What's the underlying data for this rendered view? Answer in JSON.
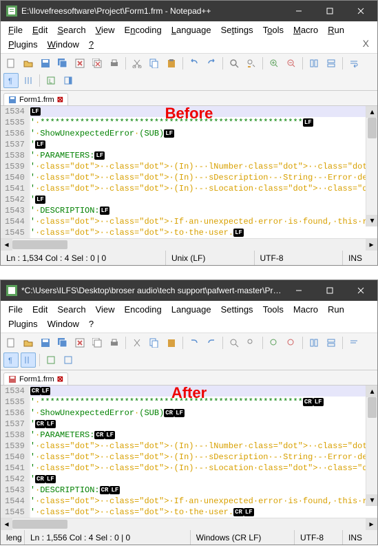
{
  "before": {
    "label": "Before",
    "title": "E:\\Ilovefreesoftware\\Project\\Form1.frm - Notepad++",
    "menus": [
      "File",
      "Edit",
      "Search",
      "View",
      "Encoding",
      "Language",
      "Settings",
      "Tools",
      "Macro",
      "Run",
      "Plugins",
      "Window",
      "?"
    ],
    "tab": {
      "name": "Form1.frm"
    },
    "status": {
      "pos": "Ln : 1,534    Col : 4    Sel : 0 | 0",
      "eol": "Unix (LF)",
      "enc": "UTF-8",
      "ins": "INS"
    },
    "lines": [
      {
        "n": "1534",
        "t": ""
      },
      {
        "n": "1535",
        "t": "' *****************************************************"
      },
      {
        "n": "1536",
        "t": "' ShowUnexpectedError (SUB)"
      },
      {
        "n": "1537",
        "t": "'"
      },
      {
        "n": "1538",
        "t": "' PARAMETERS:"
      },
      {
        "n": "1539",
        "t": "'  (In) - lNumber      - Long   - Error number"
      },
      {
        "n": "1540",
        "t": "'  (In) - sDescription - String - Error description"
      },
      {
        "n": "1541",
        "t": "'  (In) - sLocation    - String - Error source"
      },
      {
        "n": "1542",
        "t": "'"
      },
      {
        "n": "1543",
        "t": "' DESCRIPTION:"
      },
      {
        "n": "1544",
        "t": "'  If an unexpected error is found, this routine gets c"
      },
      {
        "n": "1545",
        "t": "'  to the user."
      }
    ],
    "eol_tag": "LF"
  },
  "after": {
    "label": "After",
    "title": "*C:\\Users\\ILFS\\Desktop\\broser audio\\tech support\\pafwert-master\\Proje...",
    "menus": [
      "File",
      "Edit",
      "Search",
      "View",
      "Encoding",
      "Language",
      "Settings",
      "Tools",
      "Macro",
      "Run",
      "Plugins",
      "Window",
      "?"
    ],
    "tab": {
      "name": "Form1.frm"
    },
    "status": {
      "pos_prefix": "leng",
      "pos": "Ln : 1,556    Col : 4    Sel : 0 | 0",
      "eol": "Windows (CR LF)",
      "enc": "UTF-8",
      "ins": "INS"
    },
    "lines": [
      {
        "n": "1534",
        "t": ""
      },
      {
        "n": "1535",
        "t": "' *****************************************************"
      },
      {
        "n": "1536",
        "t": "' ShowUnexpectedError (SUB)"
      },
      {
        "n": "1537",
        "t": "'"
      },
      {
        "n": "1538",
        "t": "' PARAMETERS:"
      },
      {
        "n": "1539",
        "t": "'  (In) - lNumber      - Long   - Error number"
      },
      {
        "n": "1540",
        "t": "'  (In) - sDescription - String - Error description"
      },
      {
        "n": "1541",
        "t": "'  (In) - sLocation    - String - Error source"
      },
      {
        "n": "1542",
        "t": "'"
      },
      {
        "n": "1543",
        "t": "' DESCRIPTION:"
      },
      {
        "n": "1544",
        "t": "'  If an unexpected error is found, this routine gets call"
      },
      {
        "n": "1545",
        "t": "'  to the user."
      }
    ],
    "eol_tag": "CRLF"
  },
  "icons": {
    "colors": {
      "new": "#f5f5f5",
      "open": "#e8c060",
      "save": "#5a8fd0",
      "saveall": "#5a8fd0",
      "close": "#d06060",
      "closeall": "#d06060",
      "print": "#888",
      "cut": "#888",
      "copy": "#5a8fd0",
      "paste": "#d8a040",
      "undo": "#5a8fd0",
      "redo": "#5a8fd0",
      "find": "#888",
      "replace": "#888",
      "zoomin": "#5aa05a",
      "zoomout": "#d06060",
      "sync": "#5a8fd0",
      "wrap": "#5a8fd0",
      "ws": "#5a8fd0",
      "indent": "#5a8fd0",
      "fold": "#5a8fd0",
      "lang": "#5aa05a",
      "rec": "#d06060",
      "play": "#5aa05a",
      "stop": "#888"
    }
  }
}
